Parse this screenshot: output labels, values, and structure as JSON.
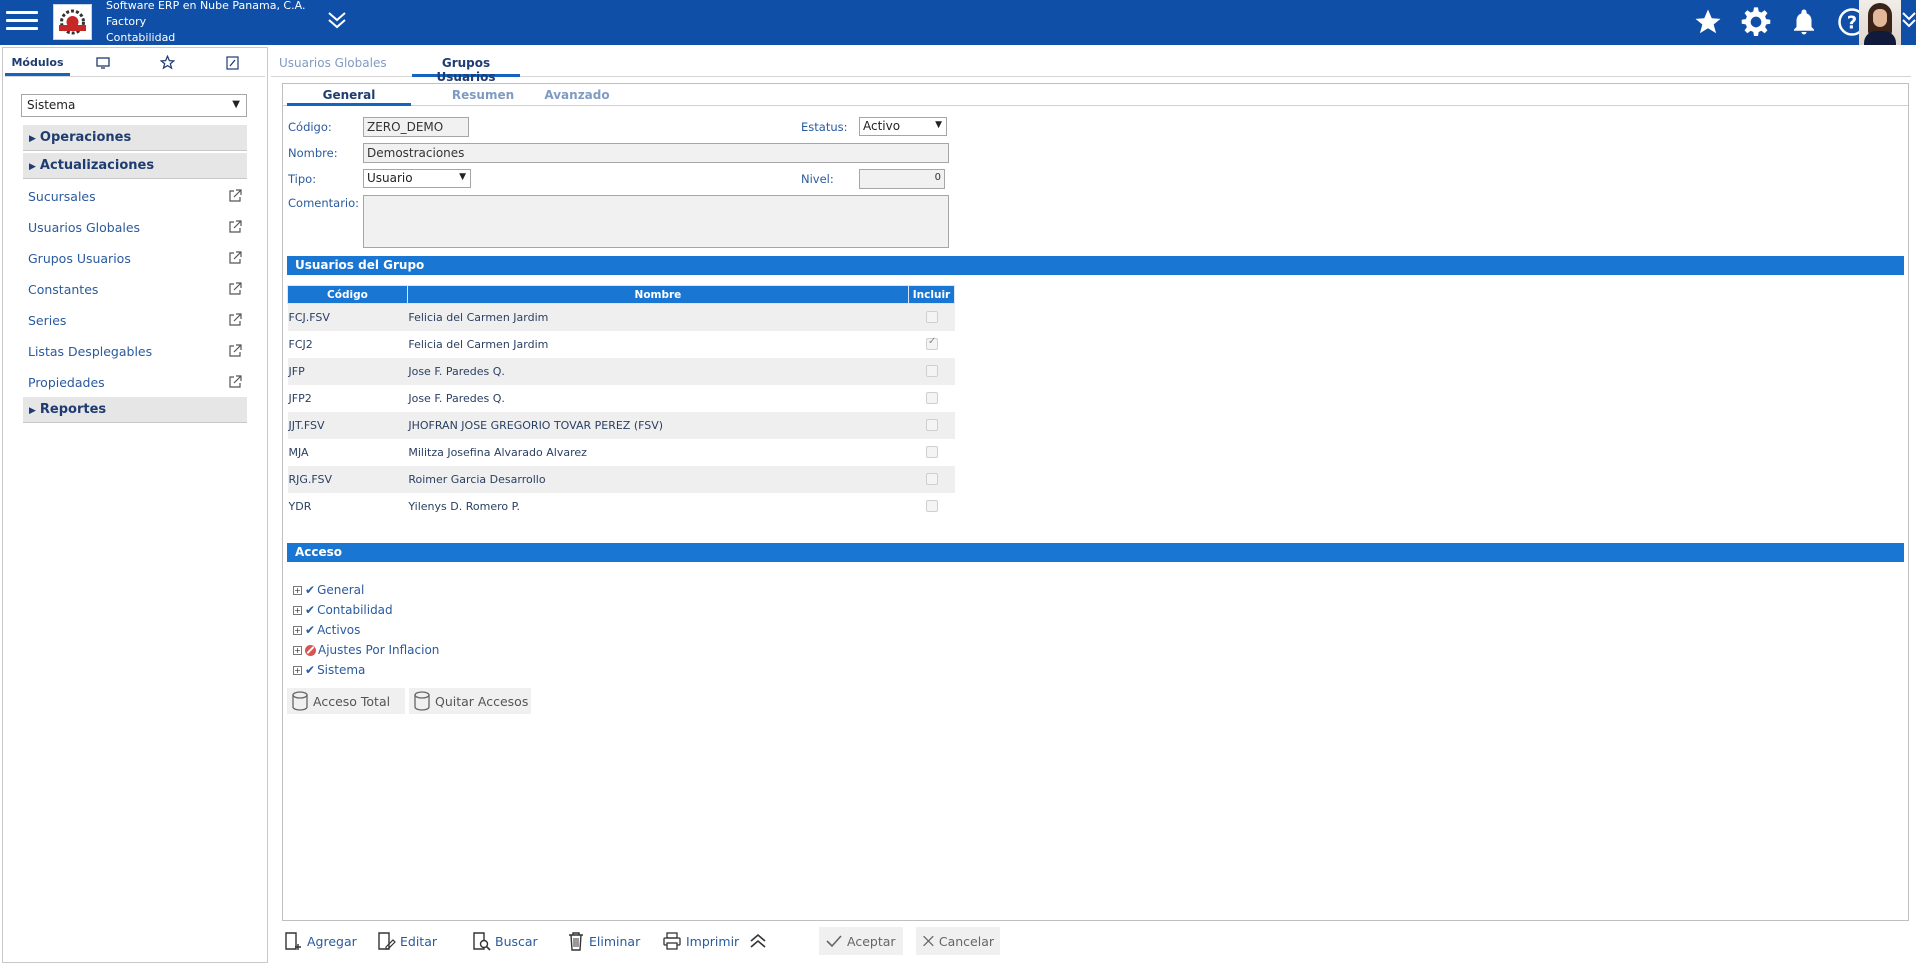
{
  "header": {
    "company_line1": "Software ERP en Nube Panama, C.A.",
    "company_line2": "Factory",
    "company_line3": "Contabilidad"
  },
  "left_panel": {
    "tabs": [
      "Módulos",
      "monitor-icon",
      "star-icon",
      "edit-icon"
    ],
    "tab_modulos": "Módulos",
    "module_select": "Sistema",
    "groups": {
      "operaciones": "Operaciones",
      "actualizaciones": "Actualizaciones",
      "reportes": "Reportes"
    },
    "items": [
      "Sucursales",
      "Usuarios Globales",
      "Grupos Usuarios",
      "Constantes",
      "Series",
      "Listas Desplegables",
      "Propiedades"
    ]
  },
  "main_tabs": [
    "Usuarios Globales",
    "Grupos Usuarios"
  ],
  "sub_tabs": [
    "General",
    "Resumen",
    "Avanzado"
  ],
  "form": {
    "codigo_label": "Código:",
    "codigo_value": "ZERO_DEMO",
    "estatus_label": "Estatus:",
    "estatus_value": "Activo",
    "nombre_label": "Nombre:",
    "nombre_value": "Demostraciones",
    "tipo_label": "Tipo:",
    "tipo_value": "Usuario",
    "nivel_label": "Nivel:",
    "nivel_value": "0",
    "comentario_label": "Comentario:",
    "comentario_value": ""
  },
  "usuarios_section": {
    "title": "Usuarios del Grupo",
    "columns": [
      "Código",
      "Nombre",
      "Incluir"
    ],
    "rows": [
      {
        "codigo": "FCJ.FSV",
        "nombre": "Felicia del Carmen Jardim",
        "incluir": false
      },
      {
        "codigo": "FCJ2",
        "nombre": "Felicia del Carmen Jardim",
        "incluir": true
      },
      {
        "codigo": "JFP",
        "nombre": "Jose F. Paredes Q.",
        "incluir": false
      },
      {
        "codigo": "JFP2",
        "nombre": "Jose F. Paredes Q.",
        "incluir": false
      },
      {
        "codigo": "JJT.FSV",
        "nombre": "JHOFRAN JOSE GREGORIO TOVAR PEREZ (FSV)",
        "incluir": false
      },
      {
        "codigo": "MJA",
        "nombre": "Militza Josefina Alvarado Alvarez",
        "incluir": false
      },
      {
        "codigo": "RJG.FSV",
        "nombre": "Roimer Garcia Desarrollo",
        "incluir": false
      },
      {
        "codigo": "YDR",
        "nombre": "Yilenys D. Romero P.",
        "incluir": false
      }
    ]
  },
  "acceso_section": {
    "title": "Acceso",
    "tree": [
      {
        "label": "General",
        "status": "granted"
      },
      {
        "label": "Contabilidad",
        "status": "granted"
      },
      {
        "label": "Activos",
        "status": "granted"
      },
      {
        "label": "Ajustes Por Inflacion",
        "status": "denied"
      },
      {
        "label": "Sistema",
        "status": "granted"
      }
    ],
    "acceso_total": "Acceso Total",
    "quitar_accesos": "Quitar Accesos"
  },
  "toolbar": {
    "agregar": "Agregar",
    "editar": "Editar",
    "buscar": "Buscar",
    "eliminar": "Eliminar",
    "imprimir": "Imprimir",
    "aceptar": "Aceptar",
    "cancelar": "Cancelar"
  },
  "colors": {
    "header": "#0f4fa8",
    "section": "#1976d2",
    "link": "#2a5a9e"
  }
}
